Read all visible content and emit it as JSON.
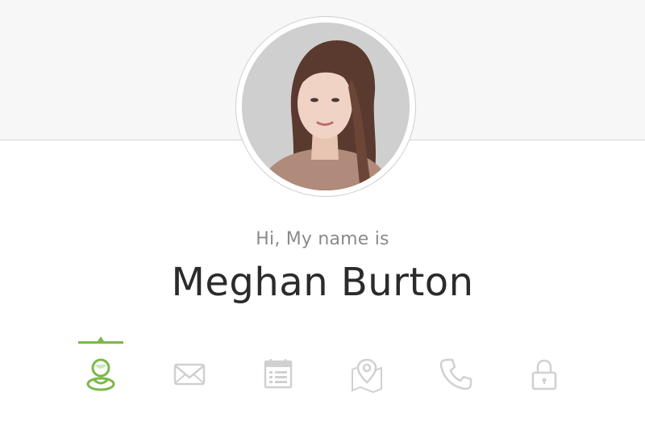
{
  "profile": {
    "greeting": "Hi, My name is",
    "name": "Meghan Burton",
    "avatar_alt": "profile photo"
  },
  "nav": {
    "active_color": "#7bb84a",
    "inactive_color": "#d0d0d0",
    "items": [
      {
        "icon": "user-icon",
        "active": true
      },
      {
        "icon": "envelope-icon",
        "active": false
      },
      {
        "icon": "calendar-icon",
        "active": false
      },
      {
        "icon": "map-pin-icon",
        "active": false
      },
      {
        "icon": "phone-icon",
        "active": false
      },
      {
        "icon": "lock-icon",
        "active": false
      }
    ]
  }
}
